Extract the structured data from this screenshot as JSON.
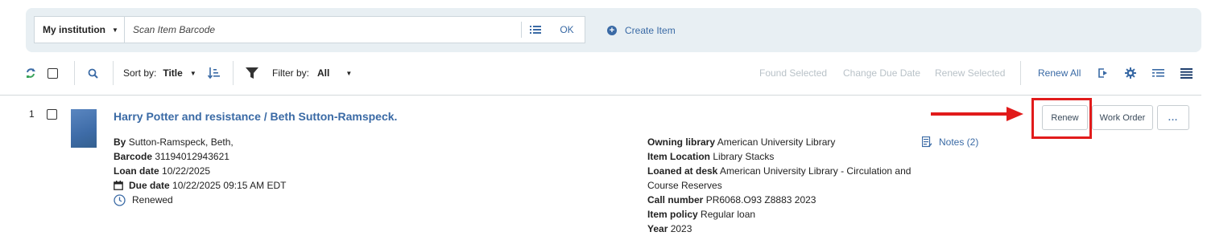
{
  "scan": {
    "institution": "My institution",
    "placeholder": "Scan Item Barcode",
    "ok_label": "OK",
    "create_label": "Create Item"
  },
  "toolbar": {
    "sort_label": "Sort by:",
    "sort_value": "Title",
    "filter_label": "Filter by:",
    "filter_value": "All",
    "found_selected": "Found Selected",
    "change_due_date": "Change Due Date",
    "renew_selected": "Renew Selected",
    "renew_all": "Renew All"
  },
  "item": {
    "index": "1",
    "title": "Harry Potter and resistance / Beth Sutton-Ramspeck.",
    "by_label": "By",
    "by_value": "Sutton-Ramspeck, Beth,",
    "barcode_label": "Barcode",
    "barcode_value": "31194012943621",
    "loan_date_label": "Loan date",
    "loan_date_value": "10/22/2025",
    "due_date_label": "Due date",
    "due_date_value": "10/22/2025 09:15 AM EDT",
    "status": "Renewed",
    "owning_library_label": "Owning library",
    "owning_library_value": "American University Library",
    "item_location_label": "Item Location",
    "item_location_value": "Library Stacks",
    "loaned_at_desk_label": "Loaned at desk",
    "loaned_at_desk_value": "American University Library - Circulation and Course Reserves",
    "call_number_label": "Call number",
    "call_number_value": "PR6068.O93 Z8883 2023",
    "item_policy_label": "Item policy",
    "item_policy_value": "Regular loan",
    "year_label": "Year",
    "year_value": "2023",
    "notes_label": "Notes (2)"
  },
  "actions": {
    "renew": "Renew",
    "work_order": "Work Order",
    "more": "..."
  },
  "colors": {
    "accent": "#3a6aa5",
    "highlight": "#e11b1b",
    "refresh_green": "#3aa35b"
  }
}
